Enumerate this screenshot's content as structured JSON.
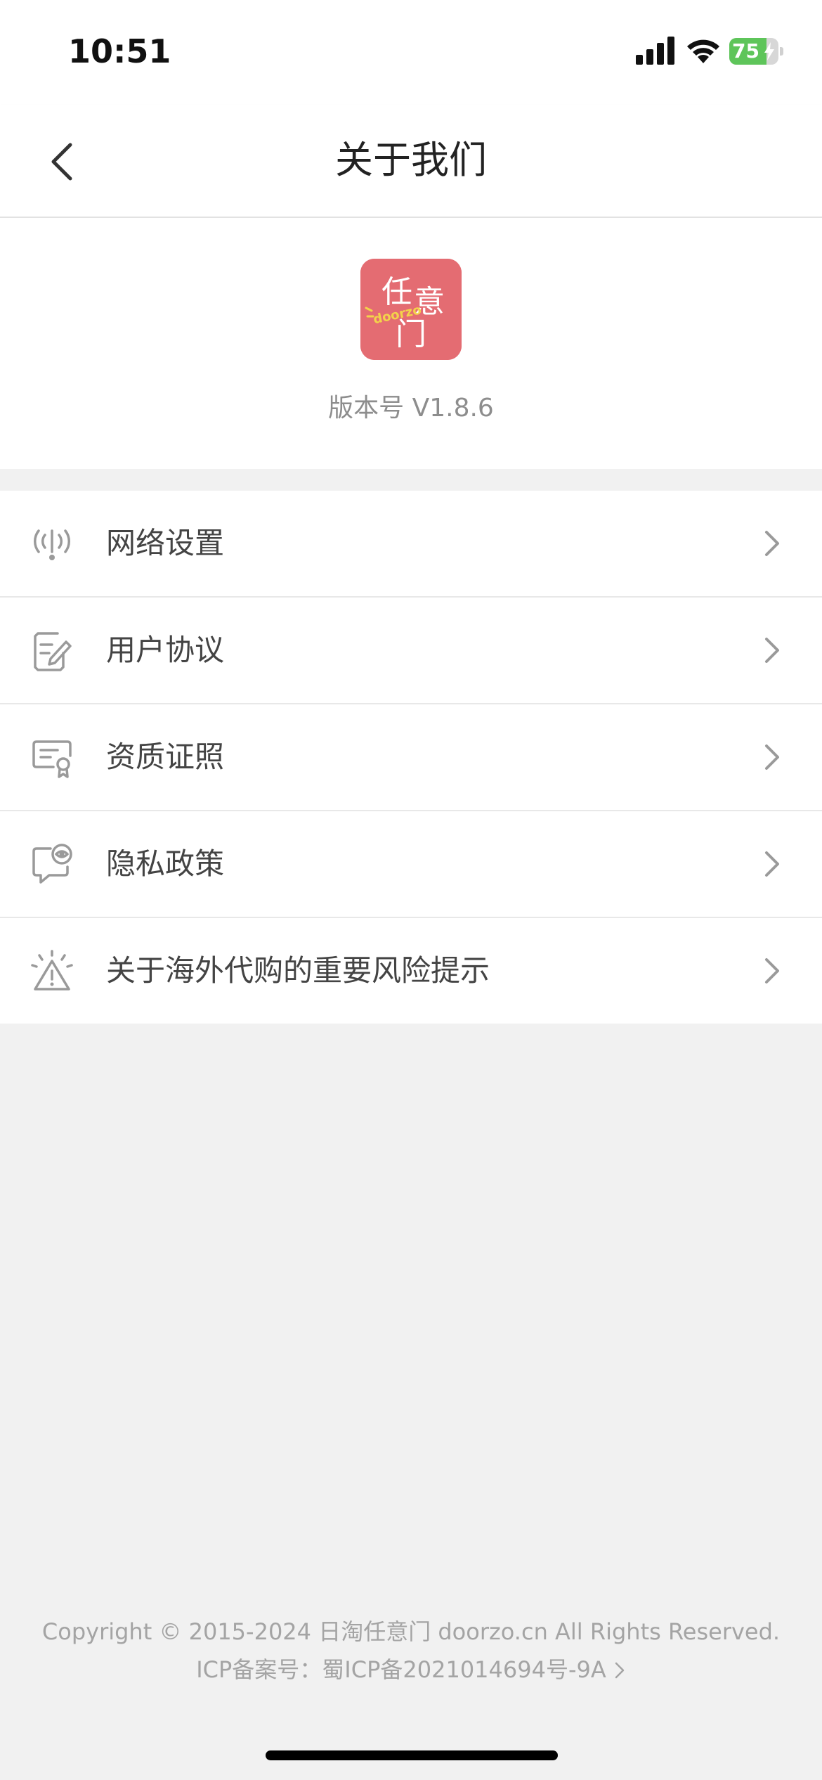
{
  "status_bar": {
    "time": "10:51",
    "battery_level": "75",
    "battery_percent": 75,
    "battery_color": "#5ec55a",
    "icons": [
      "signal-icon",
      "wifi-icon",
      "battery-icon",
      "charging-bolt-icon"
    ]
  },
  "nav": {
    "title": "关于我们",
    "back_icon": "chevron-left-icon"
  },
  "app": {
    "logo_text_top_left": "任",
    "logo_text_top_right": "意",
    "logo_text_bottom": "门",
    "logo_text_brand": "doorzo",
    "logo_color": "#e46c72",
    "version_text": "版本号 V1.8.6"
  },
  "menu": {
    "items": [
      {
        "label": "网络设置",
        "icon": "network-signal-icon"
      },
      {
        "label": "用户协议",
        "icon": "document-edit-icon"
      },
      {
        "label": "资质证照",
        "icon": "certificate-icon"
      },
      {
        "label": "隐私政策",
        "icon": "privacy-eye-chat-icon"
      },
      {
        "label": "关于海外代购的重要风险提示",
        "icon": "warning-triangle-icon"
      }
    ],
    "chevron_icon": "chevron-right-icon"
  },
  "footer": {
    "copyright": "Copyright © 2015-2024 日淘任意门 doorzo.cn All Rights Reserved.",
    "icp": "ICP备案号：蜀ICP备2021014694号-9A"
  }
}
